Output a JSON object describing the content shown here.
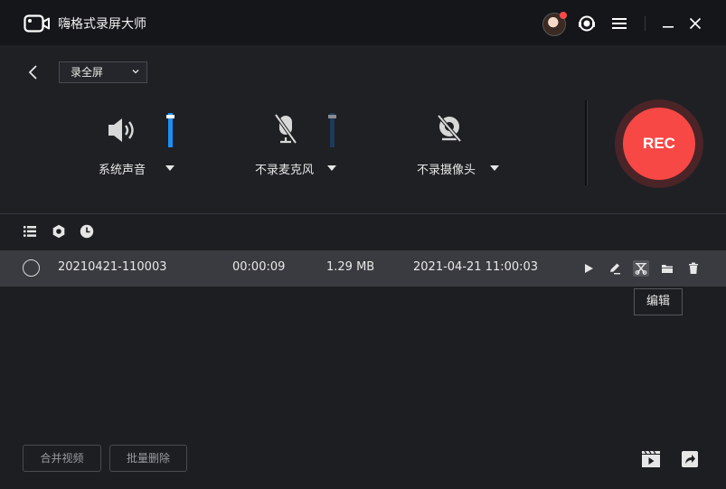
{
  "app": {
    "title": "嗨格式录屏大师"
  },
  "titlebar": {
    "icons": [
      "avatar",
      "support-icon",
      "menu-icon",
      "minimize-icon",
      "close-icon"
    ]
  },
  "controls": {
    "mode_select": {
      "value": "录全屏"
    },
    "sources": [
      {
        "id": "system-audio",
        "label": "系统声音",
        "icon": "speaker-icon",
        "volume": 1.0
      },
      {
        "id": "microphone",
        "label": "不录麦克风",
        "icon": "microphone-off-icon",
        "volume": 1.0
      },
      {
        "id": "camera",
        "label": "不录摄像头",
        "icon": "camera-off-icon"
      }
    ],
    "rec_button": {
      "label": "REC",
      "color": "#f74846"
    }
  },
  "list_toolbar": [
    "list-icon",
    "settings-icon",
    "clock-icon"
  ],
  "recordings": [
    {
      "name": "20210421-110003",
      "duration": "00:00:09",
      "size": "1.29 MB",
      "created": "2021-04-21 11:00:03",
      "actions": [
        "play-icon",
        "rename-icon",
        "edit-icon",
        "folder-icon",
        "delete-icon"
      ]
    }
  ],
  "tooltip": {
    "text": "编辑"
  },
  "bottom": {
    "merge_label": "合并视频",
    "batch_delete_label": "批量删除",
    "icons": [
      "video-editor-icon",
      "share-icon"
    ]
  },
  "colors": {
    "accent": "#1e8ff5",
    "rec": "#f74846",
    "background": "#1d1e22"
  }
}
